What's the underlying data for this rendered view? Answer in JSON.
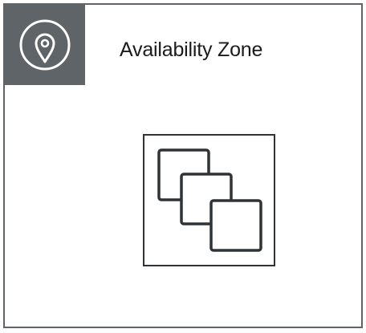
{
  "group": {
    "title": "Availability Zone",
    "badge_icon": "map-pin-icon",
    "content_icon": "instances-icon"
  },
  "colors": {
    "border": "#5f6468",
    "badge_background": "#5f6468",
    "icon_stroke": "#2f3336",
    "badge_icon_stroke": "#ffffff",
    "title_text": "#1b1b1b"
  }
}
